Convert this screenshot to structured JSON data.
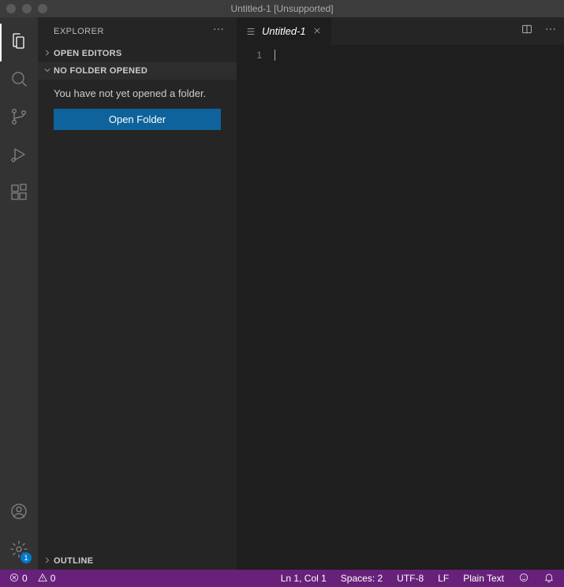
{
  "titlebar": {
    "title": "Untitled-1 [Unsupported]"
  },
  "sidebar": {
    "title": "EXPLORER",
    "sections": {
      "open_editors": {
        "label": "OPEN EDITORS"
      },
      "no_folder": {
        "label": "NO FOLDER OPENED",
        "message": "You have not yet opened a folder.",
        "button": "Open Folder"
      },
      "outline": {
        "label": "OUTLINE"
      }
    }
  },
  "activity": {
    "settings_badge": "1"
  },
  "editor": {
    "tab": {
      "name": "Untitled-1"
    },
    "line_number": "1"
  },
  "status": {
    "errors": "0",
    "warnings": "0",
    "cursor_pos": "Ln 1, Col 1",
    "indent": "Spaces: 2",
    "encoding": "UTF-8",
    "eol": "LF",
    "language": "Plain Text"
  }
}
